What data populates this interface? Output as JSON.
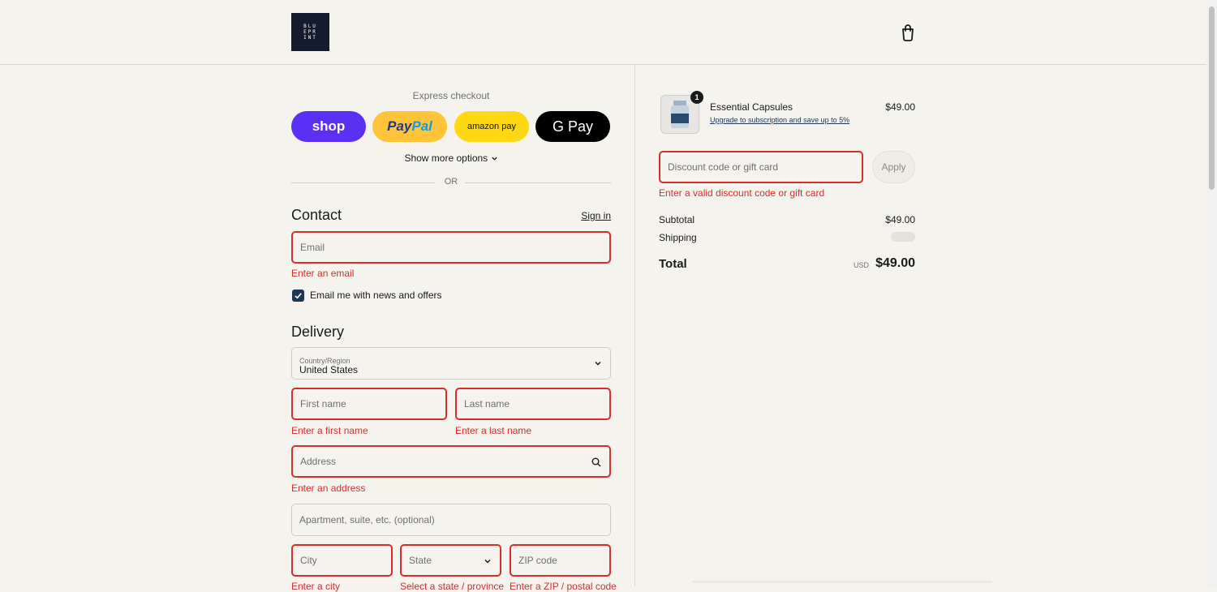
{
  "header": {
    "logo_text": "BLU\nEPR\nINT",
    "cart_icon": "shopping-bag-icon"
  },
  "express": {
    "label": "Express checkout",
    "shop_label": "shop",
    "paypal_pay": "Pay",
    "paypal_pal": "Pal",
    "amazon_label": "amazon pay",
    "gpay_label": "G Pay",
    "more_options": "Show more options",
    "or_label": "OR"
  },
  "contact": {
    "title": "Contact",
    "signin": "Sign in",
    "email_placeholder": "Email",
    "email_error": "Enter an email",
    "newsletter_label": "Email me with news and offers",
    "newsletter_checked": true
  },
  "delivery": {
    "title": "Delivery",
    "country_label": "Country/Region",
    "country_value": "United States",
    "first_name_placeholder": "First name",
    "first_name_error": "Enter a first name",
    "last_name_placeholder": "Last name",
    "last_name_error": "Enter a last name",
    "address_placeholder": "Address",
    "address_error": "Enter an address",
    "apartment_placeholder": "Apartment, suite, etc. (optional)",
    "city_placeholder": "City",
    "city_error": "Enter a city",
    "state_placeholder": "State",
    "state_error": "Select a state / province",
    "zip_placeholder": "ZIP code",
    "zip_error": "Enter a ZIP / postal code"
  },
  "summary": {
    "product": {
      "quantity": "1",
      "name": "Essential Capsules",
      "upsell_link": "Upgrade to subscription and save up to 5%",
      "price": "$49.00"
    },
    "discount_placeholder": "Discount code or gift card",
    "apply_label": "Apply",
    "discount_error": "Enter a valid discount code or gift card",
    "subtotal_label": "Subtotal",
    "subtotal_value": "$49.00",
    "shipping_label": "Shipping",
    "total_label": "Total",
    "total_currency": "USD",
    "total_value": "$49.00"
  },
  "colors": {
    "error": "#d92d2d",
    "background": "#f5f3ee",
    "shop_pay": "#5a31f4",
    "paypal": "#ffc439",
    "amazon_pay": "#ffd814",
    "checkbox": "#1e3553"
  }
}
